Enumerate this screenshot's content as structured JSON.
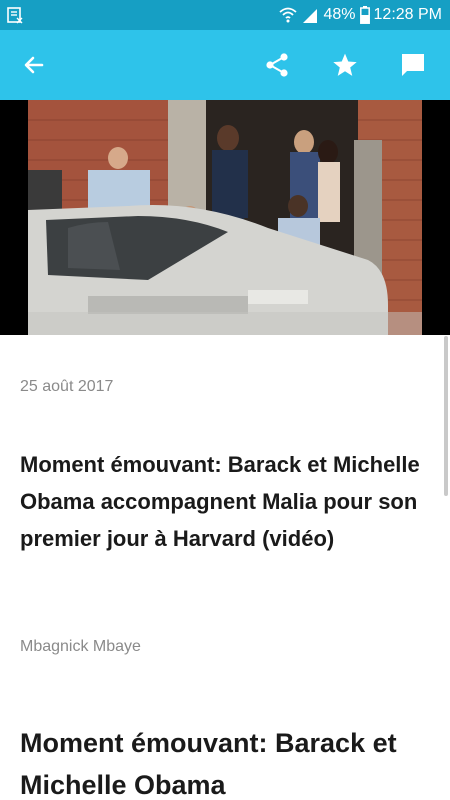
{
  "status_bar": {
    "battery": "48%",
    "time": "12:28 PM"
  },
  "toolbar": {
    "back_icon": "arrow-left-icon",
    "share_icon": "share-icon",
    "favorite_icon": "star-icon",
    "comment_icon": "comment-icon"
  },
  "article": {
    "date": "25 août 2017",
    "title": "Moment émouvant: Barack et Michelle Obama accompagnent Malia pour son premier jour à Harvard (vidéo)",
    "author": "Mbagnick Mbaye",
    "body_heading": "Moment émouvant: Barack et Michelle Obama"
  },
  "colors": {
    "status_bar": "#169fc4",
    "app_bar": "#2ec3ea"
  }
}
